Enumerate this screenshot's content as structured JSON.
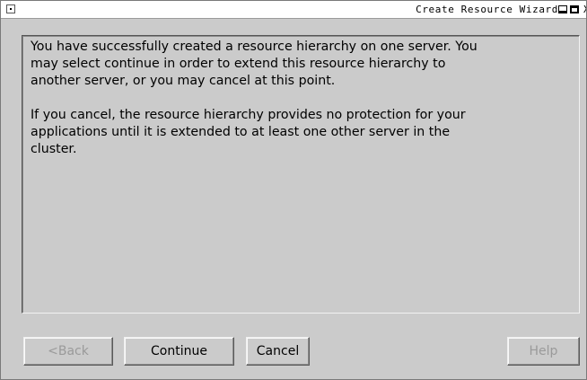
{
  "window": {
    "title": "Create Resource Wizard",
    "close_glyph": "X"
  },
  "message": {
    "paragraph1": "You have successfully created a resource hierarchy on one server.  You\nmay select continue in order to extend this resource hierarchy to\nanother server, or you may cancel at this point.",
    "paragraph2": "If you cancel, the resource hierarchy provides no protection for your\napplications until it is extended to at least one other server in the\ncluster."
  },
  "buttons": {
    "back": "<Back",
    "continue": "Continue",
    "cancel": "Cancel",
    "help": "Help"
  },
  "icons": {
    "system_menu": "system-menu-icon",
    "minimize": "minimize-icon",
    "maximize": "maximize-icon",
    "close": "close-icon"
  },
  "colors": {
    "window_bg": "#cbcbcb",
    "title_bg": "#ffffff",
    "disabled_text": "#9a9a9a"
  }
}
